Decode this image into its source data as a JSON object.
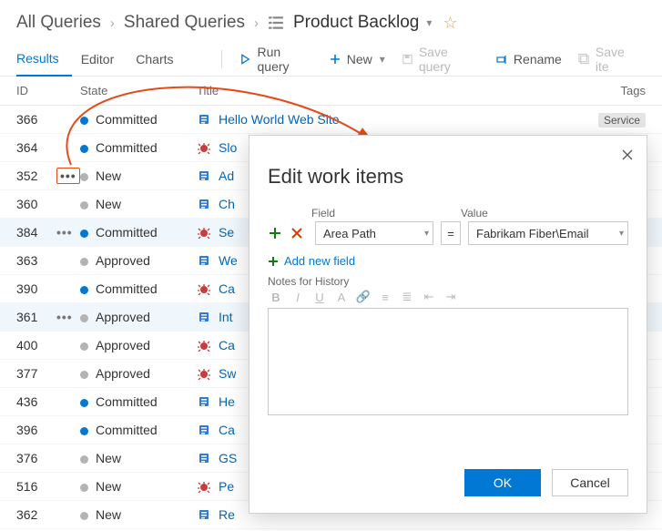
{
  "breadcrumb": {
    "all_queries": "All Queries",
    "shared_queries": "Shared Queries",
    "current": "Product Backlog"
  },
  "tabs": {
    "results": "Results",
    "editor": "Editor",
    "charts": "Charts"
  },
  "toolbar": {
    "run_query": "Run query",
    "new": "New",
    "save_query": "Save query",
    "rename": "Rename",
    "save_items": "Save ite"
  },
  "columns": {
    "id": "ID",
    "state": "State",
    "title": "Title",
    "tags": "Tags"
  },
  "state_labels": {
    "committed": "Committed",
    "new": "New",
    "approved": "Approved"
  },
  "rows": [
    {
      "id": "366",
      "state": "committed",
      "dot": "blue",
      "icon": "book",
      "title": "Hello World Web Site",
      "tags": "Service",
      "dots": ""
    },
    {
      "id": "364",
      "state": "committed",
      "dot": "blue",
      "icon": "bug",
      "title": "Slo",
      "dots": ""
    },
    {
      "id": "352",
      "state": "new",
      "dot": "grey",
      "icon": "book",
      "title": "Ad",
      "dots": "highlight"
    },
    {
      "id": "360",
      "state": "new",
      "dot": "grey",
      "icon": "book",
      "title": "Ch",
      "dots": ""
    },
    {
      "id": "384",
      "state": "committed",
      "dot": "blue",
      "icon": "bug",
      "title": "Se",
      "dots": "show",
      "selected": true
    },
    {
      "id": "363",
      "state": "approved",
      "dot": "grey",
      "icon": "book",
      "title": "We",
      "dots": ""
    },
    {
      "id": "390",
      "state": "committed",
      "dot": "blue",
      "icon": "bug",
      "title": "Ca",
      "dots": ""
    },
    {
      "id": "361",
      "state": "approved",
      "dot": "grey",
      "icon": "book",
      "title": "Int",
      "dots": "show",
      "selected": true
    },
    {
      "id": "400",
      "state": "approved",
      "dot": "grey",
      "icon": "bug",
      "title": "Ca",
      "dots": ""
    },
    {
      "id": "377",
      "state": "approved",
      "dot": "grey",
      "icon": "bug",
      "title": "Sw",
      "dots": ""
    },
    {
      "id": "436",
      "state": "committed",
      "dot": "blue",
      "icon": "book",
      "title": "He",
      "dots": ""
    },
    {
      "id": "396",
      "state": "committed",
      "dot": "blue",
      "icon": "book",
      "title": "Ca",
      "dots": ""
    },
    {
      "id": "376",
      "state": "new",
      "dot": "grey",
      "icon": "book",
      "title": "GS",
      "dots": ""
    },
    {
      "id": "516",
      "state": "new",
      "dot": "grey",
      "icon": "bug",
      "title": "Pe",
      "dots": ""
    },
    {
      "id": "362",
      "state": "new",
      "dot": "grey",
      "icon": "book",
      "title": "Re",
      "dots": ""
    }
  ],
  "dialog": {
    "title": "Edit work items",
    "field_label": "Field",
    "value_label": "Value",
    "field_value": "Area Path",
    "op_value": "=",
    "value_value": "Fabrikam Fiber\\Email",
    "add_field": "Add new field",
    "notes_label": "Notes for History",
    "ok": "OK",
    "cancel": "Cancel"
  }
}
